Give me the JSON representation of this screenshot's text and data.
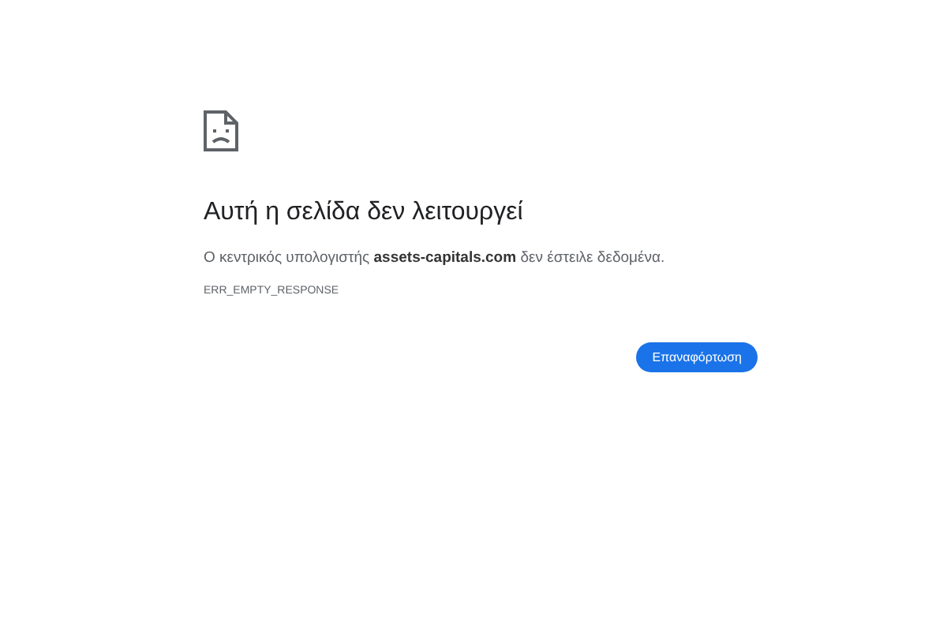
{
  "title": "Αυτή η σελίδα δεν λειτουργεί",
  "message": "Ο κεντρικός υπολογιστής **assets-capitals.com** δεν έστειλε δεδομένα.",
  "error_code": "ERR_EMPTY_RESPONSE",
  "button": "Επαναφόρτωση"
}
